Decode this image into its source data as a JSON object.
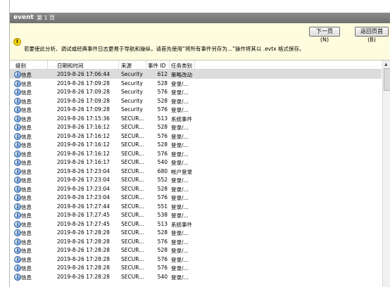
{
  "header": {
    "title": "event",
    "page": "第 1 页"
  },
  "buttons": {
    "next": "下一页(N)",
    "back": "返回页首(B)"
  },
  "info_message": "若要使此分析、调试或经典事件日志更易于导航和操纵，请首先使用“将所有事件另存为...”操作将其以 .evtx 格式保存。",
  "columns": {
    "level": "级别",
    "datetime": "日期和时间",
    "source": "来源",
    "event_id": "事件 ID",
    "task": "任务类别"
  },
  "rows": [
    {
      "level": "信息",
      "datetime": "2019-8-26 17:06:44",
      "source": "Security",
      "event_id": "612",
      "task": "策略改动"
    },
    {
      "level": "信息",
      "datetime": "2019-8-26 17:09:28",
      "source": "Security",
      "event_id": "528",
      "task": "登录/..."
    },
    {
      "level": "信息",
      "datetime": "2019-8-26 17:09:28",
      "source": "Security",
      "event_id": "576",
      "task": "登录/..."
    },
    {
      "level": "信息",
      "datetime": "2019-8-26 17:09:28",
      "source": "Security",
      "event_id": "528",
      "task": "登录/..."
    },
    {
      "level": "信息",
      "datetime": "2019-8-26 17:09:28",
      "source": "Security",
      "event_id": "576",
      "task": "登录/..."
    },
    {
      "level": "信息",
      "datetime": "2019-8-26 17:15:36",
      "source": "SECUR...",
      "event_id": "513",
      "task": "系统事件"
    },
    {
      "level": "信息",
      "datetime": "2019-8-26 17:16:12",
      "source": "SECUR...",
      "event_id": "528",
      "task": "登录/..."
    },
    {
      "level": "信息",
      "datetime": "2019-8-26 17:16:12",
      "source": "SECUR...",
      "event_id": "576",
      "task": "登录/..."
    },
    {
      "level": "信息",
      "datetime": "2019-8-26 17:16:12",
      "source": "SECUR...",
      "event_id": "528",
      "task": "登录/..."
    },
    {
      "level": "信息",
      "datetime": "2019-8-26 17:16:12",
      "source": "SECUR...",
      "event_id": "576",
      "task": "登录/..."
    },
    {
      "level": "信息",
      "datetime": "2019-8-26 17:16:17",
      "source": "SECUR...",
      "event_id": "540",
      "task": "登录/..."
    },
    {
      "level": "信息",
      "datetime": "2019-8-26 17:23:04",
      "source": "SECUR...",
      "event_id": "680",
      "task": "帐户登录"
    },
    {
      "level": "信息",
      "datetime": "2019-8-26 17:23:04",
      "source": "SECUR...",
      "event_id": "552",
      "task": "登录/..."
    },
    {
      "level": "信息",
      "datetime": "2019-8-26 17:23:04",
      "source": "SECUR...",
      "event_id": "528",
      "task": "登录/..."
    },
    {
      "level": "信息",
      "datetime": "2019-8-26 17:23:04",
      "source": "SECUR...",
      "event_id": "576",
      "task": "登录/..."
    },
    {
      "level": "信息",
      "datetime": "2019-8-26 17:27:44",
      "source": "SECUR...",
      "event_id": "551",
      "task": "登录/..."
    },
    {
      "level": "信息",
      "datetime": "2019-8-26 17:27:45",
      "source": "SECUR...",
      "event_id": "538",
      "task": "登录/..."
    },
    {
      "level": "信息",
      "datetime": "2019-8-26 17:27:45",
      "source": "SECUR...",
      "event_id": "513",
      "task": "系统事件"
    },
    {
      "level": "信息",
      "datetime": "2019-8-26 17:28:28",
      "source": "SECUR...",
      "event_id": "528",
      "task": "登录/..."
    },
    {
      "level": "信息",
      "datetime": "2019-8-26 17:28:28",
      "source": "SECUR...",
      "event_id": "576",
      "task": "登录/..."
    },
    {
      "level": "信息",
      "datetime": "2019-8-26 17:28:28",
      "source": "SECUR...",
      "event_id": "528",
      "task": "登录/..."
    },
    {
      "level": "信息",
      "datetime": "2019-8-26 17:28:28",
      "source": "SECUR...",
      "event_id": "576",
      "task": "登录/..."
    },
    {
      "level": "信息",
      "datetime": "2019-8-26 17:28:28",
      "source": "SECUR...",
      "event_id": "576",
      "task": "登录/..."
    },
    {
      "level": "信息",
      "datetime": "2019-8-26 17:28:28",
      "source": "SECUR...",
      "event_id": "540",
      "task": "登录/..."
    }
  ],
  "selected_row": 0,
  "colors": {
    "titlebar": "#7a7a7a",
    "infobar": "#fdfcde",
    "selected": "#dcdcdc"
  }
}
